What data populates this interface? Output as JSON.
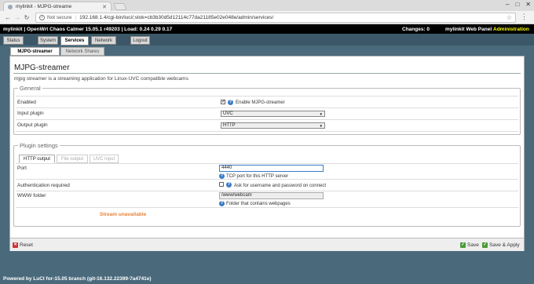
{
  "browser": {
    "tab_title": "mylinkit - MJPG-streame",
    "address_security": "Not secure",
    "url": "192.168.1.4/cgi-bin/luci/;stok=cb3b30d5d12114c77da21185e02e048e/admin/services/"
  },
  "header": {
    "info": "mylinkit | OpenWrt Chaos Calmer 15.05.1 r49203 | Load: 0.24 0.29 0.17",
    "changes": "Changes: 0",
    "panel": "mylinkit Web Panel",
    "admin": "Administration"
  },
  "main_menu": [
    "Status",
    "System",
    "Services",
    "Network",
    "Logout"
  ],
  "sub_menu": [
    "MJPG-streamer",
    "Network Shares"
  ],
  "page": {
    "title": "MJPG-streamer",
    "description": "mjpg streamer is a streaming application for Linux-UVC compatible webcams"
  },
  "general": {
    "legend": "General",
    "enabled_label": "Enabled",
    "enabled_hint": "Enable MJPG-streamer",
    "enabled_checked": "✓",
    "input_label": "Input plugin",
    "input_value": "UVC",
    "output_label": "Output plugin",
    "output_value": "HTTP"
  },
  "plugin": {
    "legend": "Plugin settings",
    "tabs": [
      "HTTP output",
      "File output",
      "UVC input"
    ],
    "port_label": "Port",
    "port_value": "4440",
    "port_hint": "TCP port for this HTTP server",
    "auth_label": "Authentication required",
    "auth_hint": "Ask for username and password on connect",
    "www_label": "WWW folder",
    "www_value": "/www/webcam",
    "www_hint": "Folder that contains webpages",
    "stream_status": "Stream unavailable"
  },
  "buttons": {
    "reset": "Reset",
    "save": "Save",
    "save_apply": "Save & Apply"
  },
  "footer": "Powered by LuCI for-15.05 branch (git-16.132.22399-7a4741e)"
}
